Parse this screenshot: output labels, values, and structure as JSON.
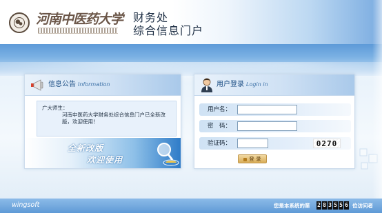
{
  "header": {
    "university_name": "河南中医药大学",
    "department": "财务处",
    "portal_name": "综合信息门户"
  },
  "notice": {
    "title": "信息公告",
    "title_en": "Information",
    "greeting": "广大师生：",
    "body": "河南中医药大学财务处综合信息门户已全新改版，欢迎使用！",
    "promo_line1": "全新改版",
    "promo_line2": "欢迎使用"
  },
  "login": {
    "title": "用户登录",
    "title_en": "Login in",
    "username_label": "用户名：",
    "username_value": "",
    "password_label": "密　码：",
    "password_value": "",
    "captcha_label": "验证码：",
    "captcha_value": "",
    "captcha_text": "0270",
    "submit_label": "登 录"
  },
  "footer": {
    "brand": "wingsoft",
    "visit_prefix": "您是本系统的第",
    "visit_digits": [
      "2",
      "8",
      "3",
      "5",
      "5",
      "6"
    ],
    "visit_suffix": "位访问者"
  },
  "colors": {
    "header_text": "#1e2f45",
    "panel_title": "#1d4f85",
    "footer_bg": "#6fa6dc",
    "counter_bg": "#111111"
  },
  "icons": {
    "logo": "university-seal-icon",
    "notice": "megaphone-icon",
    "login": "user-icon",
    "promo": "magnifier-icon"
  }
}
